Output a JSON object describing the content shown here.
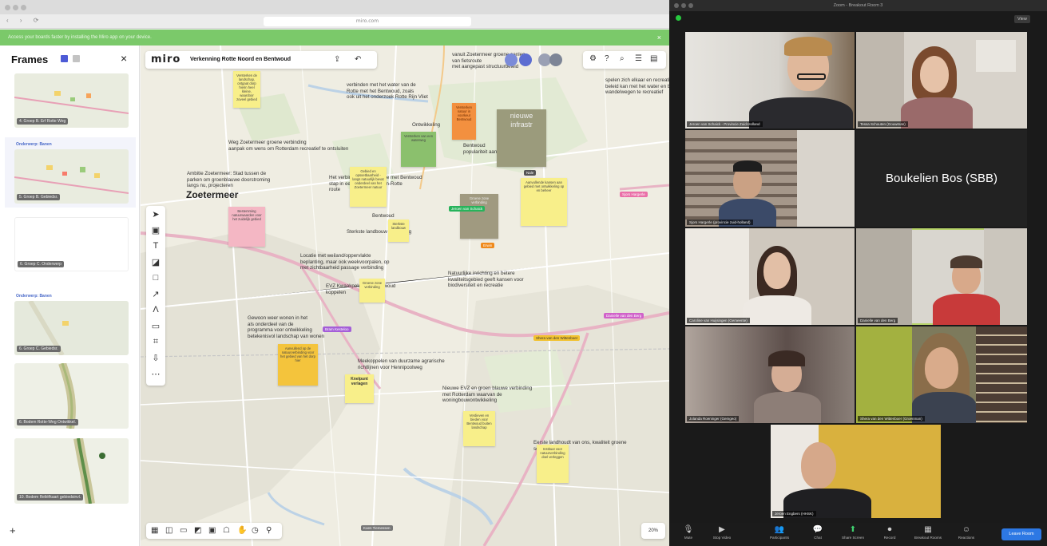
{
  "browser": {
    "url": "miro.com",
    "banner_text": "Access your boards faster by installing the Miro app on your device.",
    "banner_close": "×"
  },
  "frames_panel": {
    "title": "Frames",
    "close": "×",
    "add": "+",
    "frames": [
      {
        "label": "4. Groep B. Erf Rotte Weg",
        "tag": ""
      },
      {
        "label": "5. Groep B. Gebiedsr.",
        "tag": "Onderwerp: Banen"
      },
      {
        "label": "6. Groep C. Onderwerp",
        "tag": ""
      },
      {
        "label": "6. Groep C. Gebiedsr.",
        "tag": "Onderwerp: Banen"
      },
      {
        "label": "6. Bodem Rotte-Weg Ontwikkel.",
        "tag": ""
      },
      {
        "label": "10. Bodem Reliëfkaart gebiedsinvl.",
        "tag": ""
      }
    ]
  },
  "miro": {
    "logo": "miro",
    "board_name": "Verkenning Rotte Noord en Bentwoud",
    "zoom": "20%",
    "city_label": "Zoetermeer",
    "user_tag": "Koen Tiemessen"
  },
  "map_texts": [
    {
      "id": "t1",
      "text": "verbinden met het water van de\nRotte met het Bentwoud, zoals\nook uit het onderzoek Rotte Rijn Vliet"
    },
    {
      "id": "t2",
      "text": "Ontwikkeling"
    },
    {
      "id": "t3",
      "text": "Bentwoud\npopulariteit aanwezig"
    },
    {
      "id": "t4",
      "text": "Weg Zoetermeer groene verbinding\naanpak om wens om Rotterdam recreatief te ontsluiten"
    },
    {
      "id": "t5",
      "text": "Ambitie Zoetermeer: Stad tussen de\nparken om groenblauwe doorstroming\nlangs nu, projecteren"
    },
    {
      "id": "t6",
      "text": "Het verbinden van de Rotte met Bentwoud\nstap in een recreatieve Rijn-Rotte\nroute"
    },
    {
      "id": "t7",
      "text": "Bentwoud"
    },
    {
      "id": "t8",
      "text": "Sterkste landbouw verbinding"
    },
    {
      "id": "t9",
      "text": "Locatie met weiland/oppervlakte\nbeplanting, maar ook weekvoorpalen, op\nmet zichtbaarheid passage verbinding"
    },
    {
      "id": "t10",
      "text": "Natuurlijke inrichting en betere\nkwaliteitsgebied geeft kansen voor\nbiodiversiteit en recreatie"
    },
    {
      "id": "t11",
      "text": "EVZ Kwaakpolder en Bentwoud\nkoppelen"
    },
    {
      "id": "t12",
      "text": "Gewoon weer wonen in het\nals onderdeel van de\nprogramma voor ontwikkeling\nbetekenisvol landschap van wonen"
    },
    {
      "id": "t13",
      "text": "Meekoppelen van duurzame agrarische\nrichtlijnen voor Hennipoolweg"
    },
    {
      "id": "t14",
      "text": "Nieuwe EVZ en groen blauwe verbinding\nmet Rotterdam waarvan de\nwoningbouwontwikkeling"
    },
    {
      "id": "t15",
      "text": "Eerste landhoudt van ons, kwaliteit groene\nschakel"
    },
    {
      "id": "t16",
      "text": "vanuit Zoetermeer groene aanleg\nvan fietsroute\nmet aangepast structuurbeleid"
    },
    {
      "id": "t17",
      "text": "spelen zich elkaar en recreatief af, over het\nbeleid kan met het water en bijzonder\nwandelwegen te recreatief"
    }
  ],
  "notes": [
    {
      "id": "n1",
      "text": "Versterken de landschap, ontgaat dorp hierin heel kleine, waardoor zoveel gebied"
    },
    {
      "id": "n2",
      "text": "Versterken natuur in voorkeur Bentwoud"
    },
    {
      "id": "n3",
      "text": "nieuwe infrastr"
    },
    {
      "id": "n4",
      "text": "Versterken van een waterweg"
    },
    {
      "id": "n5",
      "text": "Gebied en opsoetbaarheid - langs natuurlijk bevat onderdeel van het Zoetermeer natuur"
    },
    {
      "id": "n6",
      "text": "Aanvullende kansen aan gebied met ontwikkeling op en beheer"
    },
    {
      "id": "n7",
      "text": "Bestemming natuurwaarden voor het zuidelijk gebied"
    },
    {
      "id": "n8",
      "text": "Sterkste landbouw"
    },
    {
      "id": "n9",
      "text": "Groene zone verbinding"
    },
    {
      "id": "n10",
      "text": "Aanvullend op de natuurverbinding voor het gebied van het dorp hier"
    },
    {
      "id": "n11",
      "text": "Knelpunt verlagen"
    },
    {
      "id": "n12",
      "text": "Verdieven en bieden voor Bentwoud buiten landschap"
    },
    {
      "id": "n13",
      "text": "Instituut voor natuurverbinding doel verleggen"
    }
  ],
  "cursor_tags": [
    {
      "id": "c1",
      "text": "Jeroen van Schaick",
      "color": "#27b35b"
    },
    {
      "id": "c2",
      "text": "Shera van den Wittenboer",
      "color": "#f2c230"
    },
    {
      "id": "c3",
      "text": "Danielle van den Berg",
      "color": "#d061c9"
    },
    {
      "id": "c4",
      "text": "Bram Kesteloo",
      "color": "#a45ed8"
    },
    {
      "id": "c5",
      "text": "Sjors Hargerle",
      "color": "#ea6fa8"
    },
    {
      "id": "c6",
      "text": "Erwin",
      "color": "#f08a1b"
    },
    {
      "id": "c7",
      "text": "Nale",
      "color": "#555"
    }
  ],
  "zoom": {
    "window_title": "Zoom - Breakout Room 3",
    "view_label": "View",
    "participants": [
      {
        "name": "Jeroen van Schaick - Provincie Zuid-Holland"
      },
      {
        "name": "Tessa Schouten (Gouwman)"
      },
      {
        "name": "Sjors Hargerle (provincie zuid-holland)"
      },
      {
        "name": "Boukelien Bos (SBB)"
      },
      {
        "name": "Caroline van Huijsingen (Gemeente)"
      },
      {
        "name": "Danielle van den Berg"
      },
      {
        "name": "Jolanda Roeninger (Gemgeo)"
      },
      {
        "name": "Shera van den Wittenboer (Groenman)"
      },
      {
        "name": "Jeroen Engbers (HHSK)"
      }
    ],
    "controls": [
      {
        "label": "Mute",
        "icon": "microphone-icon",
        "glyph": "🎙"
      },
      {
        "label": "Stop Video",
        "icon": "video-camera-icon",
        "glyph": "▶"
      },
      {
        "label": "Participants",
        "icon": "participants-icon",
        "glyph": "👥"
      },
      {
        "label": "Chat",
        "icon": "chat-icon",
        "glyph": "💬"
      },
      {
        "label": "Share Screen",
        "icon": "share-screen-icon",
        "glyph": "⬆"
      },
      {
        "label": "Record",
        "icon": "record-icon",
        "glyph": "⏺"
      },
      {
        "label": "Breakout Rooms",
        "icon": "breakout-rooms-icon",
        "glyph": "▦"
      },
      {
        "label": "Reactions",
        "icon": "reactions-icon",
        "glyph": "☺"
      }
    ],
    "leave_label": "Leave Room"
  }
}
